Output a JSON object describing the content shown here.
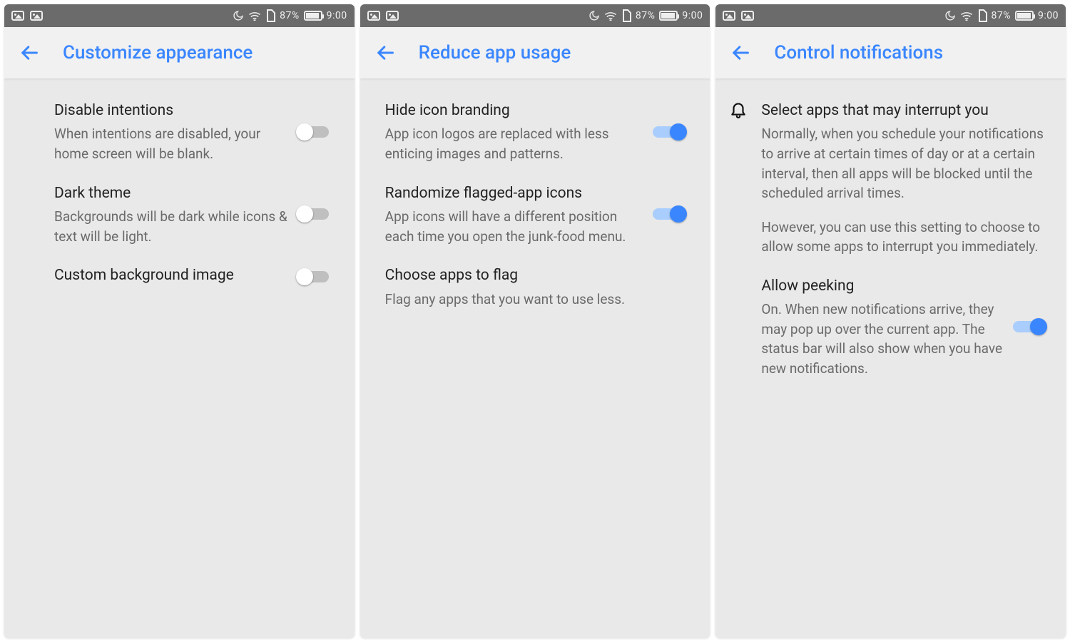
{
  "status": {
    "battery_pct": "87%",
    "time": "9:00"
  },
  "screens": [
    {
      "title": "Customize appearance",
      "rows": [
        {
          "title": "Disable intentions",
          "sub": "When intentions are disabled, your home screen will be blank.",
          "toggle": "off"
        },
        {
          "title": "Dark theme",
          "sub": "Backgrounds will be dark while icons & text will be light.",
          "toggle": "off"
        },
        {
          "title": "Custom background image",
          "sub": "",
          "toggle": "off"
        }
      ]
    },
    {
      "title": "Reduce app usage",
      "rows": [
        {
          "title": "Hide icon branding",
          "sub": "App icon logos are replaced with less enticing images and patterns.",
          "toggle": "on"
        },
        {
          "title": "Randomize flagged-app icons",
          "sub": "App icons will have a different position each time you open the junk-food menu.",
          "toggle": "on"
        },
        {
          "title": "Choose apps to flag",
          "sub": "Flag any apps that you want to use less.",
          "toggle": null
        }
      ]
    },
    {
      "title": "Control notifications",
      "rows": [
        {
          "lead_icon": "bell",
          "title": "Select apps that may interrupt you",
          "sub_p1": "Normally, when you schedule your notifications to arrive at certain times of day or at a certain interval, then all apps will be blocked until the scheduled arrival times.",
          "sub_p2": "However, you can use this setting to choose to allow some apps to interrupt you immediately.",
          "toggle": null
        },
        {
          "lead_icon": null,
          "title": "Allow peeking",
          "sub": "On. When new notifications arrive, they may pop up over the current app. The status bar will also show when you have new notifications.",
          "toggle": "on"
        }
      ]
    }
  ]
}
